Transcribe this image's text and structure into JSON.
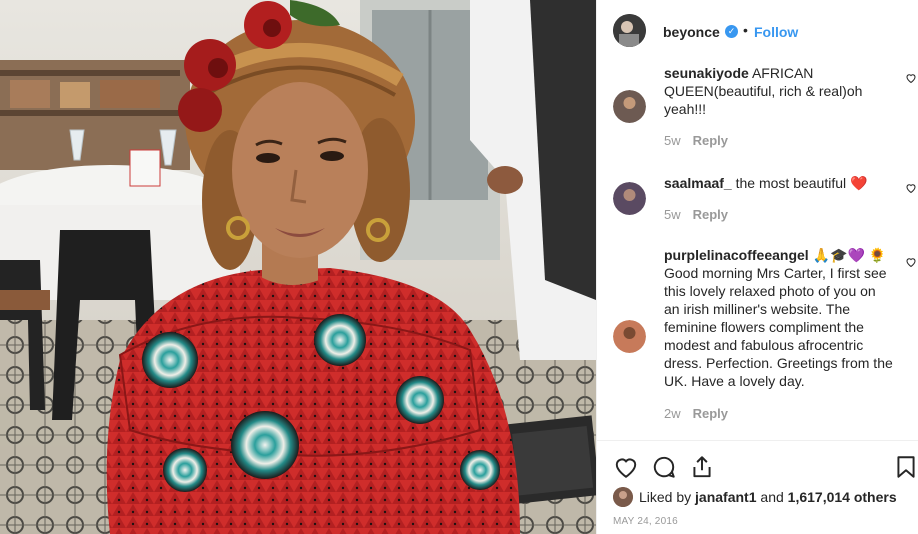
{
  "post": {
    "username": "beyonce",
    "verified_glyph": "✓",
    "separator": "•",
    "follow_label": "Follow"
  },
  "comments": [
    {
      "user": "seunakiyode",
      "text": " AFRICAN QUEEN(beautiful, rich & real)oh yeah!!!",
      "time": "5w",
      "reply": "Reply",
      "avatar_color": "#6d5a52"
    },
    {
      "user": "saalmaaf_",
      "text": " the most beautiful ❤️",
      "time": "5w",
      "reply": "Reply",
      "avatar_color": "#5a4a62"
    },
    {
      "user": "purplelinacoffeeangel",
      "text": " 🙏🎓💜 🌻 Good morning Mrs Carter, I first see this lovely relaxed photo of you on an irish milliner's website. The feminine flowers compliment the modest and fabulous afrocentric dress. Perfection. Greetings from the UK. Have a lovely day.",
      "time": "2w",
      "reply": "Reply",
      "avatar_color": "#c77a5a"
    }
  ],
  "actions": {
    "icons": [
      "heart-icon",
      "comment-icon",
      "share-icon",
      "bookmark-icon"
    ]
  },
  "likes": {
    "prefix": "Liked by ",
    "user": "janafant1",
    "middle": " and ",
    "count": "1,617,014 others"
  },
  "date": "MAY 24, 2016",
  "colors": {
    "link": "#3897f0",
    "dress_red": "#c92a2a",
    "rose_red": "#a51c1c",
    "teal_pattern": "#2aa3a1"
  }
}
